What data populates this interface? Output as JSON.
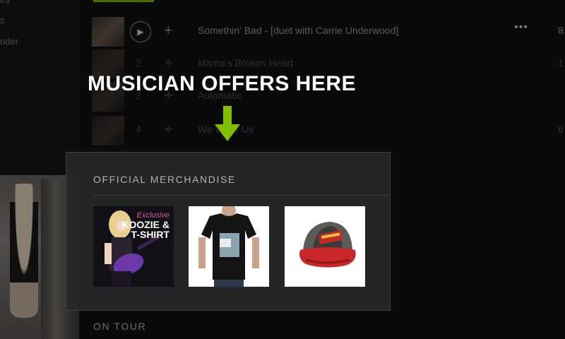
{
  "sidebar": {
    "items": [
      "es",
      "s",
      "nder"
    ]
  },
  "tracks": [
    {
      "number": "",
      "title": "Somethin' Bad - [duet with Carrie Underwood]",
      "right": "8"
    },
    {
      "number": "2",
      "title": "Mama's Broken Heart",
      "right": "1"
    },
    {
      "number": "3",
      "title": "Automatic",
      "right": ""
    },
    {
      "number": "4",
      "title": "We Were Us",
      "right": "6"
    }
  ],
  "track_actions": {
    "play_icon": "play-icon",
    "add_icon": "plus-icon",
    "more_icon": "more-icon",
    "more_label": "•••",
    "add_label": "+",
    "play_label": "▶"
  },
  "overlay": {
    "headline": "MUSICIAN OFFERS HERE",
    "arrow_color": "#84bd00"
  },
  "merch": {
    "heading": "OFFICIAL MERCHANDISE",
    "items": [
      {
        "kind": "koozie-and-shirt",
        "tag_line1": "Exclusive",
        "tag_line2": "KOOZIE &",
        "tag_line3": "T-SHIRT"
      },
      {
        "kind": "black-t-shirt"
      },
      {
        "kind": "trucker-cap"
      }
    ]
  },
  "on_tour": "ON TOUR",
  "colors": {
    "accent": "#84bd00",
    "background": "#111213",
    "panel": "#26282a"
  }
}
